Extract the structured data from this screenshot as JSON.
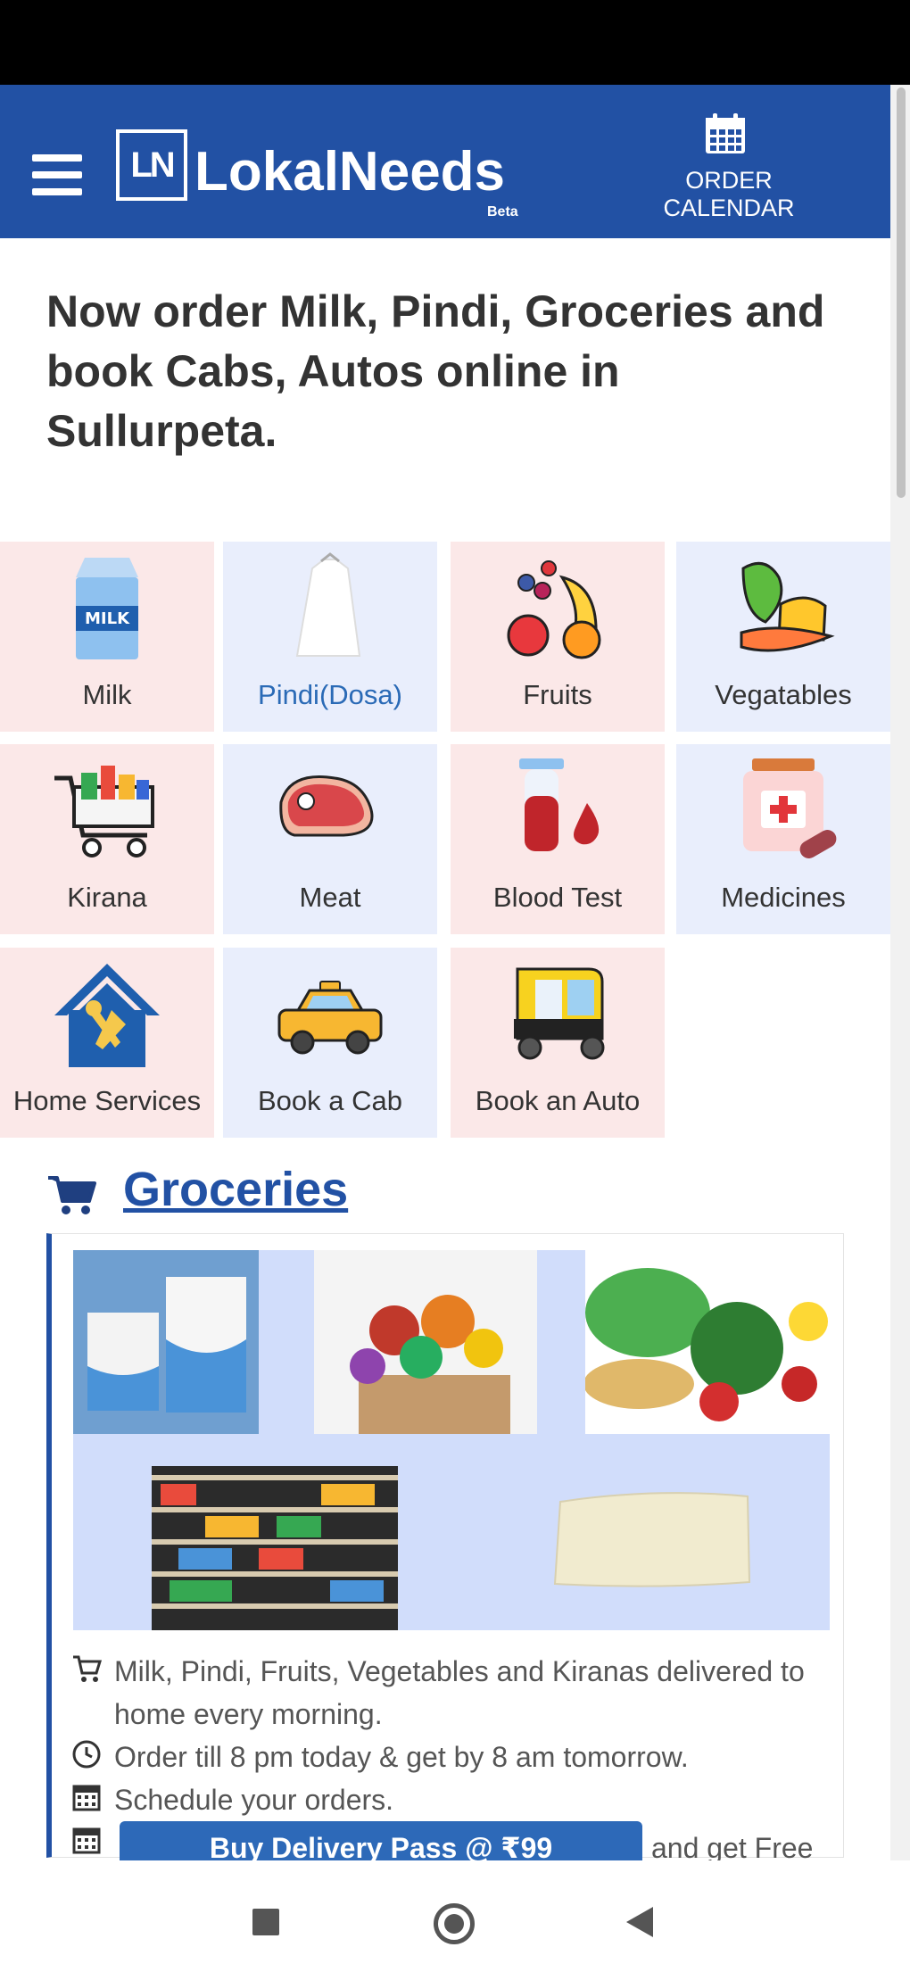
{
  "header": {
    "logo_mark": "LN",
    "logo_text": "LokalNeeds",
    "logo_badge": "Beta",
    "order_calendar_label": "ORDER CALENDAR"
  },
  "headline": "Now order Milk, Pindi, Groceries and book Cabs, Autos online in Sullurpeta.",
  "categories": [
    {
      "label": "Milk",
      "icon": "milk-carton-icon"
    },
    {
      "label": "Pindi(Dosa)",
      "icon": "flour-bag-icon"
    },
    {
      "label": "Fruits",
      "icon": "fruits-icon"
    },
    {
      "label": "Vegatables",
      "icon": "vegetables-icon"
    },
    {
      "label": "Kirana",
      "icon": "grocery-cart-icon"
    },
    {
      "label": "Meat",
      "icon": "meat-icon"
    },
    {
      "label": "Blood Test",
      "icon": "blood-test-icon"
    },
    {
      "label": "Medicines",
      "icon": "medicine-icon"
    },
    {
      "label": "Home Services",
      "icon": "home-services-icon"
    },
    {
      "label": "Book a Cab",
      "icon": "taxi-icon"
    },
    {
      "label": "Book an Auto",
      "icon": "auto-rickshaw-icon"
    }
  ],
  "groceries": {
    "title": "Groceries",
    "line1": "Milk, Pindi, Fruits, Vegetables and Kiranas delivered to home every morning.",
    "line2": "Order till 8 pm today & get by 8 am tomorrow.",
    "line3": "Schedule your orders.",
    "pass_button": "Buy Delivery Pass @ ₹99",
    "pass_tail": "and get Free"
  },
  "colors": {
    "brand": "#2251a4",
    "tile_pink": "#fbe8e8",
    "tile_blue": "#e9eefc",
    "link": "#2a6ab6"
  }
}
